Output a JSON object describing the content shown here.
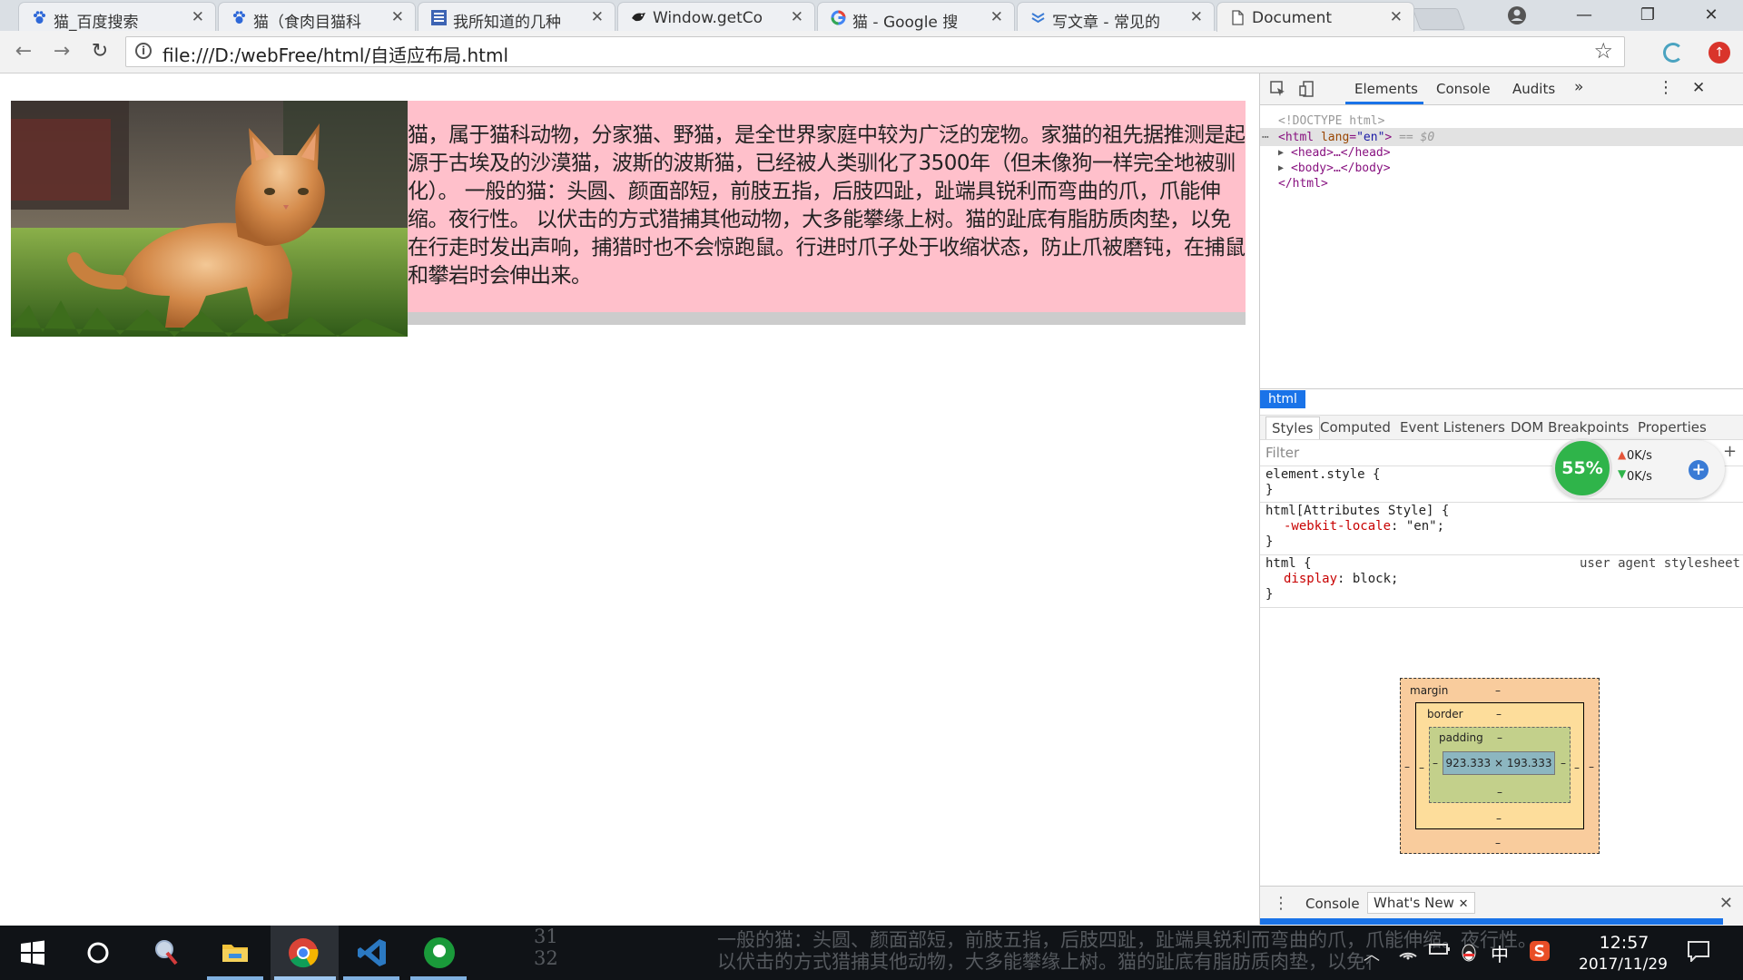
{
  "browser": {
    "tabs": [
      {
        "title": "猫_百度搜索",
        "icon": "baidu-paw-icon"
      },
      {
        "title": "猫（食肉目猫科",
        "icon": "baidu-paw-icon"
      },
      {
        "title": "我所知道的几种",
        "icon": "blog-icon"
      },
      {
        "title": "Window.getCo",
        "icon": "mdn-icon"
      },
      {
        "title": "猫 - Google 搜",
        "icon": "google-icon"
      },
      {
        "title": "写文章 - 常见的",
        "icon": "csdn-icon"
      },
      {
        "title": "Document",
        "icon": "document-icon",
        "active": true
      }
    ],
    "url": "file:///D:/webFree/html/自适应布局.html"
  },
  "page": {
    "paragraph": "猫，属于猫科动物，分家猫、野猫，是全世界家庭中较为广泛的宠物。家猫的祖先据推测是起源于古埃及的沙漠猫，波斯的波斯猫，已经被人类驯化了3500年（但未像狗一样完全地被驯化）。 一般的猫：头圆、颜面部短，前肢五指，后肢四趾，趾端具锐利而弯曲的爪，爪能伸缩。夜行性。 以伏击的方式猎捕其他动物，大多能攀缘上树。猫的趾底有脂肪质肉垫，以免在行走时发出声响，捕猎时也不会惊跑鼠。行进时爪子处于收缩状态，防止爪被磨钝，在捕鼠和攀岩时会伸出来。",
    "text_bg": "#ffc0cb",
    "container_bg": "#cccccc"
  },
  "devtools": {
    "tabs": [
      "Elements",
      "Console",
      "Audits",
      "»"
    ],
    "dom": {
      "doctype": "<!DOCTYPE html>",
      "html_open": "html",
      "lang_attr": "lang",
      "lang_val": "\"en\"",
      "sel_marker": " == $0",
      "head": "<head>…</head>",
      "body": "<body>…</body>",
      "html_close": "</html>"
    },
    "breadcrumb": "html",
    "style_tabs": [
      "Styles",
      "Computed",
      "Event Listeners",
      "DOM Breakpoints",
      "Properties"
    ],
    "filter_placeholder": "Filter",
    "rules": {
      "r1_sel": "element.style {",
      "close": "}",
      "r2_sel": "html[Attributes Style] {",
      "r2_prop": "-webkit-locale",
      "r2_val": ": \"en\";",
      "r3_sel": "html {",
      "r3_origin": "user agent stylesheet",
      "r3_prop": "display",
      "r3_val": ": block;"
    },
    "box_model": {
      "margin_label": "margin",
      "border_label": "border",
      "padding_label": "padding",
      "dash": "–",
      "content_size": "923.333 × 193.333"
    },
    "drawer_tabs": [
      "Console",
      "What's New"
    ]
  },
  "net_widget": {
    "percent": "55%",
    "up": "0K/s",
    "down": "0K/s"
  },
  "taskbar": {
    "ghost_line1": "一般的猫：头圆、颜面部短，前肢五指，后肢四趾，趾端具锐利而弯曲的爪，爪能伸缩。夜行性。",
    "ghost_line2": "以伏击的方式猎捕其他动物，大多能攀缘上树。猫的趾底有脂肪质肉垫，以免在行走时发出声响，捕猎时也不会惊跑鼠。行进时爪子处于收缩状态",
    "ghost_num1": "31",
    "ghost_num2": "32",
    "ime": "中",
    "time": "12:57",
    "date": "2017/11/29"
  }
}
